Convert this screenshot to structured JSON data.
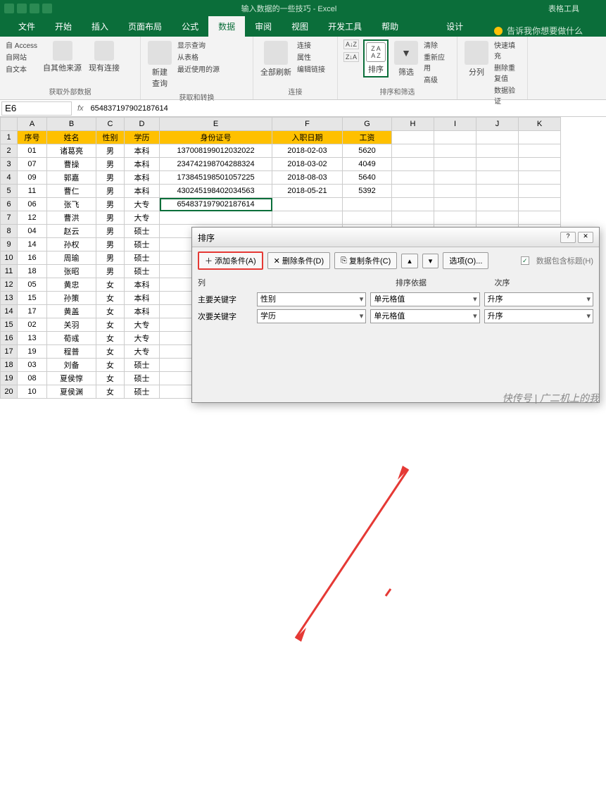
{
  "title_center": "输入数据的一些技巧 - Excel",
  "title_tools": "表格工具",
  "tabs": {
    "file": "文件",
    "home": "开始",
    "insert": "插入",
    "layout": "页面布局",
    "formula": "公式",
    "data": "数据",
    "review": "审阅",
    "view": "视图",
    "dev": "开发工具",
    "help": "帮助",
    "design": "设计",
    "tellme": "告诉我你想要做什么"
  },
  "ribbon": {
    "ext": {
      "access": "自 Access",
      "web": "自网站",
      "text": "自文本",
      "other": "自其他来源",
      "existing": "现有连接",
      "label": "获取外部数据"
    },
    "query": {
      "new": "新建\n查询",
      "show": "显示查询",
      "table": "从表格",
      "recent": "最近使用的源",
      "label": "获取和转换"
    },
    "conn": {
      "refresh": "全部刷新",
      "conn": "连接",
      "prop": "属性",
      "edit": "编辑链接",
      "label": "连接"
    },
    "sort": {
      "az": "A→Z",
      "za": "Z→A",
      "sort": "排序",
      "filter": "筛选",
      "clear": "清除",
      "reapply": "重新应用",
      "adv": "高级",
      "label": "排序和筛选"
    },
    "tools": {
      "split": "分列",
      "flash": "快速填充",
      "dup": "删除重复值",
      "valid": "数据验证"
    }
  },
  "namebox": "E6",
  "formula": "654837197902187614",
  "columns": [
    "A",
    "B",
    "C",
    "D",
    "E",
    "F",
    "G",
    "H",
    "I",
    "J",
    "K"
  ],
  "headers": {
    "A": "序号",
    "B": "姓名",
    "C": "性别",
    "D": "学历",
    "E": "身份证号",
    "F": "入职日期",
    "G": "工资"
  },
  "rows": [
    {
      "n": 2,
      "A": "01",
      "B": "诸葛亮",
      "C": "男",
      "D": "本科",
      "E": "137008199012032022",
      "F": "2018-02-03",
      "G": "5620"
    },
    {
      "n": 3,
      "A": "07",
      "B": "曹操",
      "C": "男",
      "D": "本科",
      "E": "234742198704288324",
      "F": "2018-03-02",
      "G": "4049"
    },
    {
      "n": 4,
      "A": "09",
      "B": "郭嘉",
      "C": "男",
      "D": "本科",
      "E": "173845198501057225",
      "F": "2018-08-03",
      "G": "5640"
    },
    {
      "n": 5,
      "A": "11",
      "B": "曹仁",
      "C": "男",
      "D": "本科",
      "E": "430245198402034563",
      "F": "2018-05-21",
      "G": "5392"
    },
    {
      "n": 6,
      "A": "06",
      "B": "张飞",
      "C": "男",
      "D": "大专",
      "E": "654837197902187614",
      "F": "",
      "G": ""
    },
    {
      "n": 7,
      "A": "12",
      "B": "曹洪",
      "C": "男",
      "D": "大专"
    },
    {
      "n": 8,
      "A": "04",
      "B": "赵云",
      "C": "男",
      "D": "硕士"
    },
    {
      "n": 9,
      "A": "14",
      "B": "孙权",
      "C": "男",
      "D": "硕士"
    },
    {
      "n": 10,
      "A": "16",
      "B": "周瑜",
      "C": "男",
      "D": "硕士"
    },
    {
      "n": 11,
      "A": "18",
      "B": "张昭",
      "C": "男",
      "D": "硕士"
    },
    {
      "n": 12,
      "A": "05",
      "B": "黄忠",
      "C": "女",
      "D": "本科"
    },
    {
      "n": 13,
      "A": "15",
      "B": "孙策",
      "C": "女",
      "D": "本科"
    },
    {
      "n": 14,
      "A": "17",
      "B": "黄盖",
      "C": "女",
      "D": "本科"
    },
    {
      "n": 15,
      "A": "02",
      "B": "关羽",
      "C": "女",
      "D": "大专"
    },
    {
      "n": 16,
      "A": "13",
      "B": "荀彧",
      "C": "女",
      "D": "大专"
    },
    {
      "n": 17,
      "A": "19",
      "B": "程普",
      "C": "女",
      "D": "大专"
    },
    {
      "n": 18,
      "A": "03",
      "B": "刘备",
      "C": "女",
      "D": "硕士"
    },
    {
      "n": 19,
      "A": "08",
      "B": "夏侯惇",
      "C": "女",
      "D": "硕士"
    },
    {
      "n": 20,
      "A": "10",
      "B": "夏侯渊",
      "C": "女",
      "D": "硕士"
    }
  ],
  "dialog": {
    "title": "排序",
    "add": "添加条件(A)",
    "delete": "删除条件(D)",
    "copy": "复制条件(C)",
    "options": "选项(O)...",
    "hasheader": "数据包含标题(H)",
    "col_label": "列",
    "basis_label": "排序依据",
    "order_label": "次序",
    "primary": "主要关键字",
    "secondary": "次要关键字",
    "key1": "性别",
    "key2": "学历",
    "basis": "单元格值",
    "order": "升序"
  },
  "watermark": "快传号 | 广二机上的我"
}
